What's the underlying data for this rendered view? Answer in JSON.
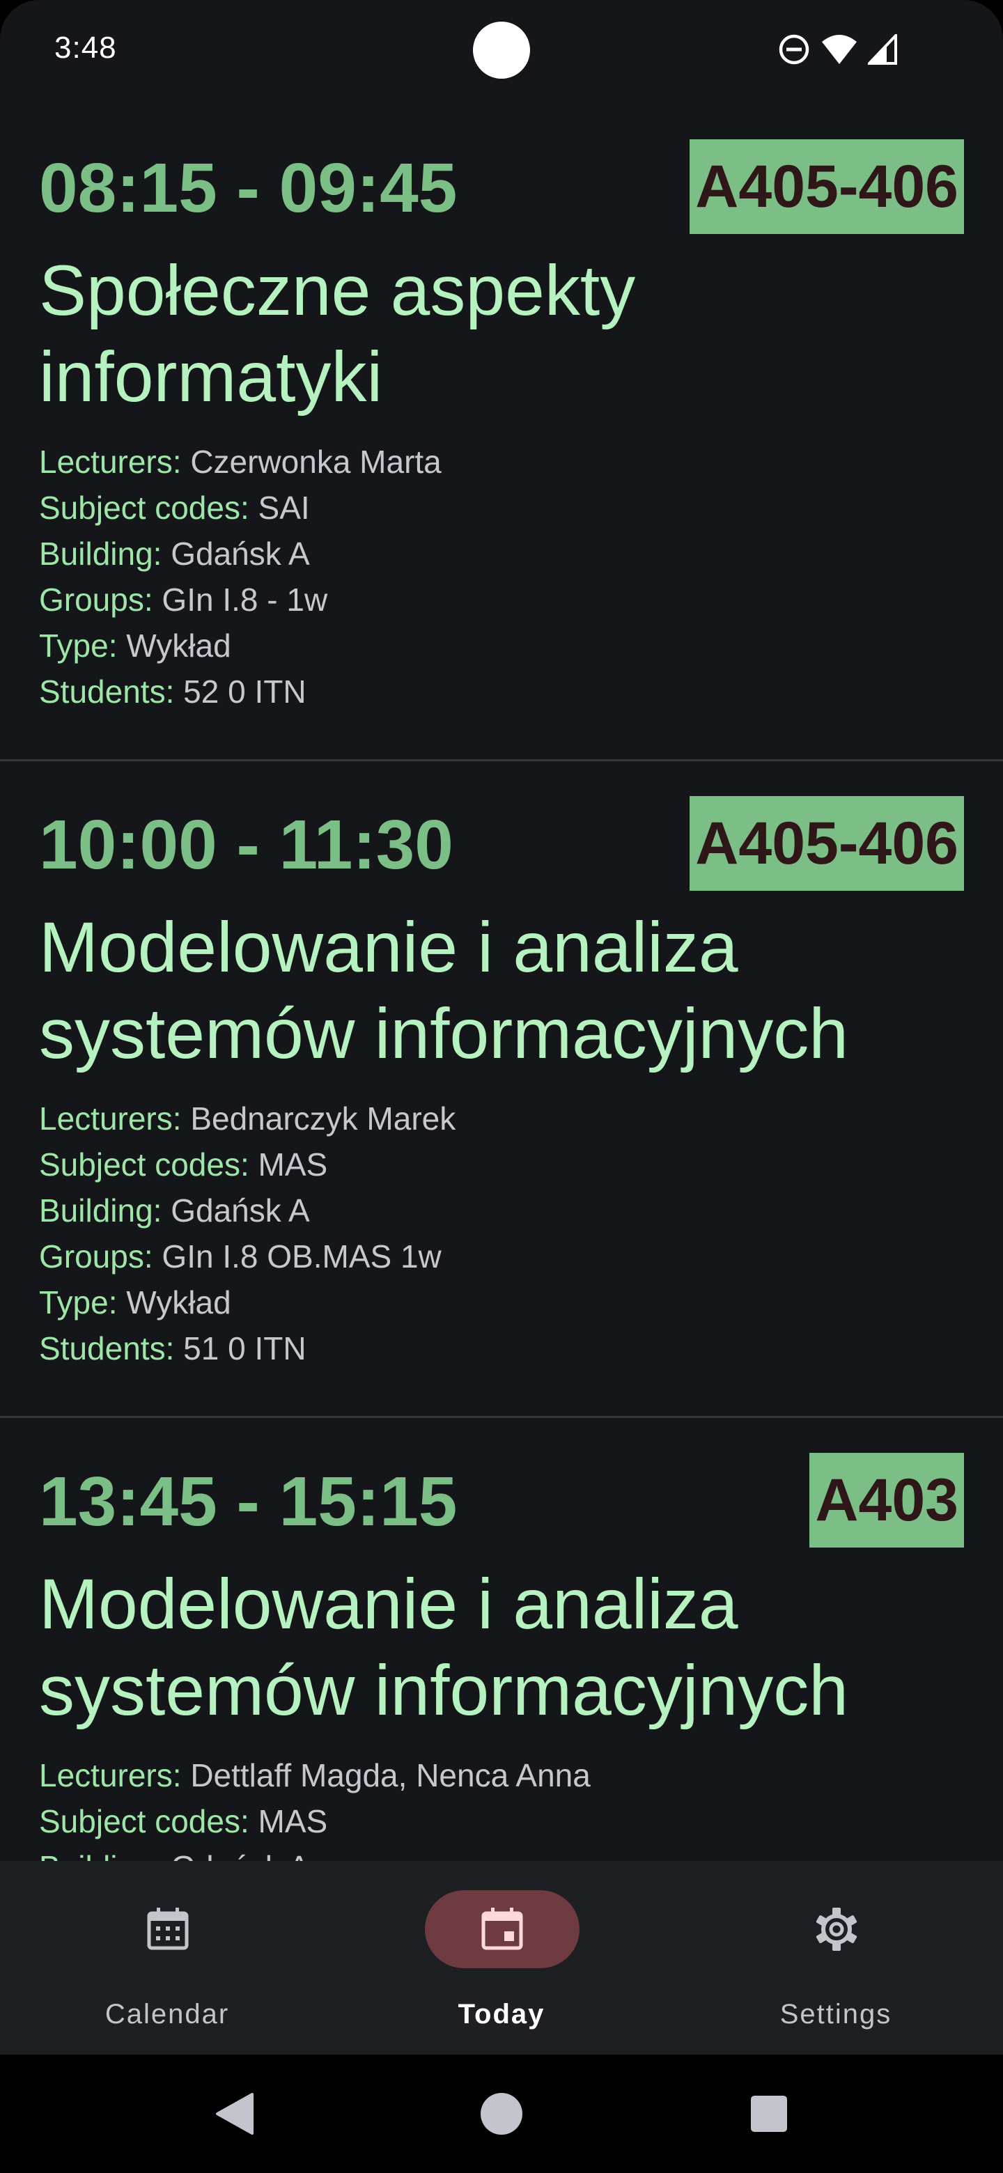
{
  "status_bar": {
    "time": "3:48",
    "icons": [
      "do-not-disturb-icon",
      "wifi-icon",
      "signal-icon"
    ]
  },
  "events": [
    {
      "time": "08:15 - 09:45",
      "room": "A405-406",
      "title": "Społeczne aspekty informatyki",
      "details": [
        {
          "key": "Lecturers:",
          "value": "Czerwonka Marta"
        },
        {
          "key": "Subject codes:",
          "value": "SAI"
        },
        {
          "key": "Building:",
          "value": "Gdańsk A"
        },
        {
          "key": "Groups:",
          "value": "GIn I.8 - 1w"
        },
        {
          "key": "Type:",
          "value": "Wykład"
        },
        {
          "key": "Students:",
          "value": "52 0 ITN"
        }
      ]
    },
    {
      "time": "10:00 - 11:30",
      "room": "A405-406",
      "title": "Modelowanie i analiza systemów informacyjnych",
      "details": [
        {
          "key": "Lecturers:",
          "value": "Bednarczyk Marek"
        },
        {
          "key": "Subject codes:",
          "value": "MAS"
        },
        {
          "key": "Building:",
          "value": "Gdańsk A"
        },
        {
          "key": "Groups:",
          "value": "GIn I.8 OB.MAS 1w"
        },
        {
          "key": "Type:",
          "value": "Wykład"
        },
        {
          "key": "Students:",
          "value": "51 0 ITN"
        }
      ]
    },
    {
      "time": "13:45 - 15:15",
      "room": "A403",
      "title": "Modelowanie i analiza systemów informacyjnych",
      "details": [
        {
          "key": "Lecturers:",
          "value": "Dettlaff Magda, Nenca Anna"
        },
        {
          "key": "Subject codes:",
          "value": "MAS"
        },
        {
          "key": "Building:",
          "value": "Gdańsk A"
        }
      ]
    }
  ],
  "bottom_nav": {
    "items": [
      {
        "label": "Calendar",
        "icon": "calendar-month-icon",
        "active": false
      },
      {
        "label": "Today",
        "icon": "calendar-today-icon",
        "active": true
      },
      {
        "label": "Settings",
        "icon": "gear-icon",
        "active": false
      }
    ]
  },
  "system_nav": {
    "buttons": [
      "back-icon",
      "home-icon",
      "recents-icon"
    ]
  },
  "colors": {
    "background": "#15161a",
    "accent": "#7cbf86",
    "title": "#b6f2bf",
    "detail_key": "#9ee6a7",
    "detail_value": "#c7c8cf",
    "badge_text": "#2f1618",
    "active_pill": "#6e3b40"
  }
}
